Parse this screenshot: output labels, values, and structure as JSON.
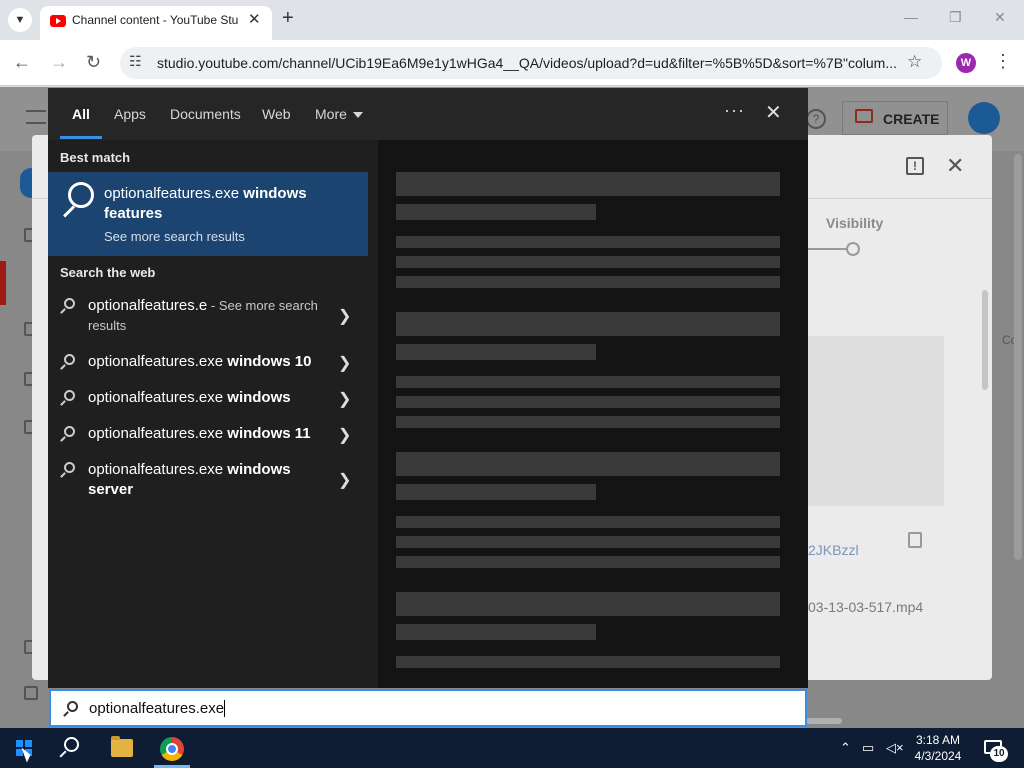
{
  "browser": {
    "tab_title": "Channel content - YouTube Stu",
    "tab_close": "✕",
    "new_tab": "+",
    "url": "studio.youtube.com/channel/UCib19Ea6M9e1y1wHGa4__QA/videos/upload?d=ud&filter=%5B%5D&sort=%7B\"colum...",
    "profile_initial": "W",
    "controls": {
      "minimize": "—",
      "maximize": "❐",
      "close": "✕"
    }
  },
  "youtube": {
    "create_label": "CREATE",
    "visibility_label": "Visibility",
    "link_fragment": "2JKBzzl",
    "file_fragment": "03-13-03-517.mp4",
    "right_fragment": "Co"
  },
  "search_panel": {
    "tabs": [
      "All",
      "Apps",
      "Documents",
      "Web",
      "More"
    ],
    "active_tab": "All",
    "dots": "···",
    "close": "✕",
    "best_match_header": "Best match",
    "best_match": {
      "title_prefix": "optionalfeatures.exe",
      "title_suffix": " windows features",
      "subtitle": "See more search results"
    },
    "web_header": "Search the web",
    "web_results": [
      {
        "main": "optionalfeatures.e",
        "suffix": " - See more search results"
      },
      {
        "main": "optionalfeatures.exe",
        "suffix_bold": " windows 10"
      },
      {
        "main": "optionalfeatures.exe",
        "suffix_bold": " windows"
      },
      {
        "main": "optionalfeatures.exe",
        "suffix_bold": " windows 11"
      },
      {
        "main": "optionalfeatures.exe",
        "suffix_bold": " windows server"
      }
    ],
    "query": "optionalfeatures.exe"
  },
  "taskbar": {
    "time": "3:18 AM",
    "date": "4/3/2024",
    "notification_count": "10"
  },
  "colors": {
    "accent": "#3a8ee6",
    "best_match_bg": "#1b4470",
    "taskbar": "#0e1d33"
  }
}
